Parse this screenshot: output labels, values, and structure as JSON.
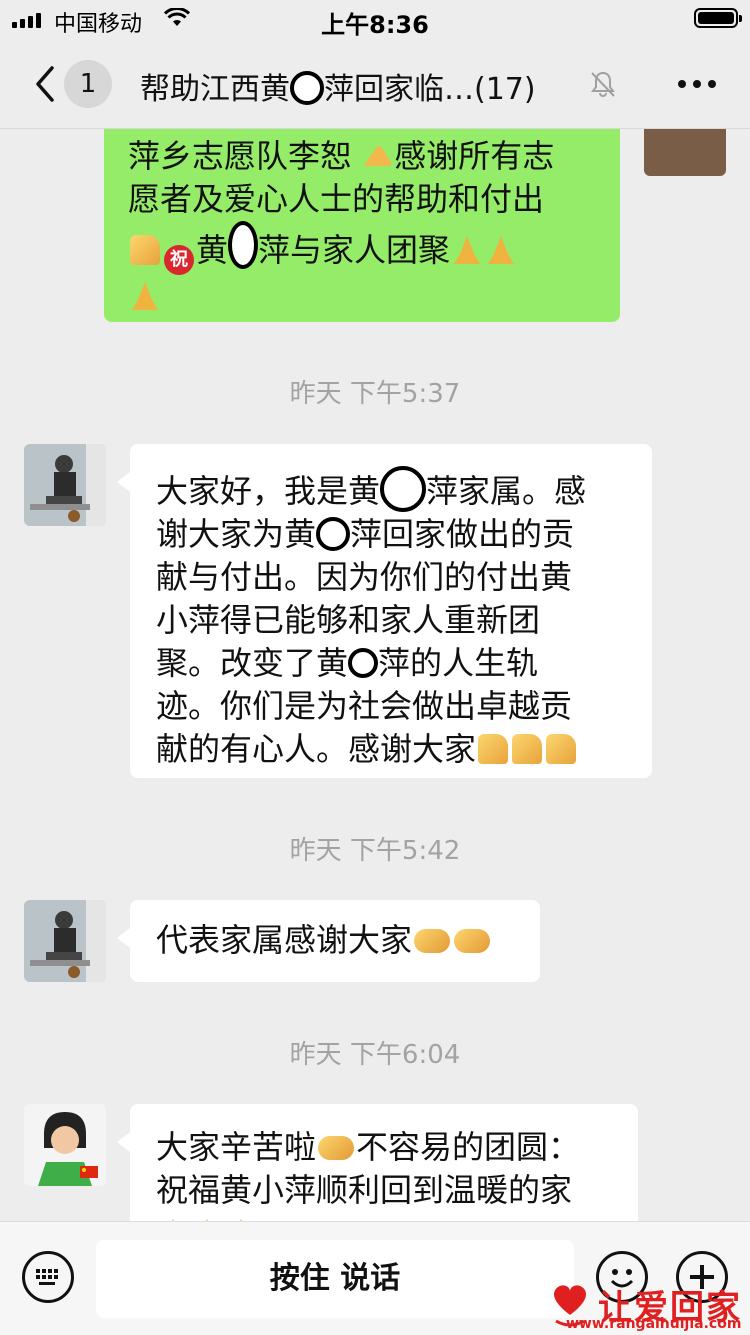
{
  "status_bar": {
    "carrier": "中国移动",
    "time": "上午8:36"
  },
  "nav": {
    "unread_count": "1",
    "title": "帮助江西黄",
    "title_mid": "萍回家临…",
    "member_count": "(17)"
  },
  "messages": {
    "m1": {
      "line1": "萍乡志愿队李恕",
      "line1b": "感谢所有志",
      "line2": "愿者及爱心人士的帮助和付出",
      "line3a": "黄",
      "line3b": "萍与家人团聚"
    },
    "t1": "昨天  下午5:37",
    "m2": {
      "l1a": "大家好，我是黄",
      "l1b": "萍家属。感",
      "l2a": "谢大家为黄",
      "l2b": "萍回家做出的贡",
      "l3": "献与付出。因为你们的付出黄",
      "l4": "小萍得已能够和家人重新团",
      "l5a": "聚。改变了黄",
      "l5b": "萍的人生轨",
      "l6": "迹。你们是为社会做出卓越贡",
      "l7": "献的有心人。感谢大家"
    },
    "t2": "昨天  下午5:42",
    "m3": {
      "text": "代表家属感谢大家"
    },
    "t3": "昨天  下午6:04",
    "m4": {
      "l1a": "大家辛苦啦",
      "l1b": "不容易的团圆：",
      "l2": "祝福黄小萍顺利回到温暖的家"
    }
  },
  "emoji": {
    "zhu": "祝"
  },
  "input_bar": {
    "hold_to_talk": "按住 说话"
  },
  "watermark": {
    "text": "让爱回家",
    "url": "www.rangaihuijia.com"
  }
}
